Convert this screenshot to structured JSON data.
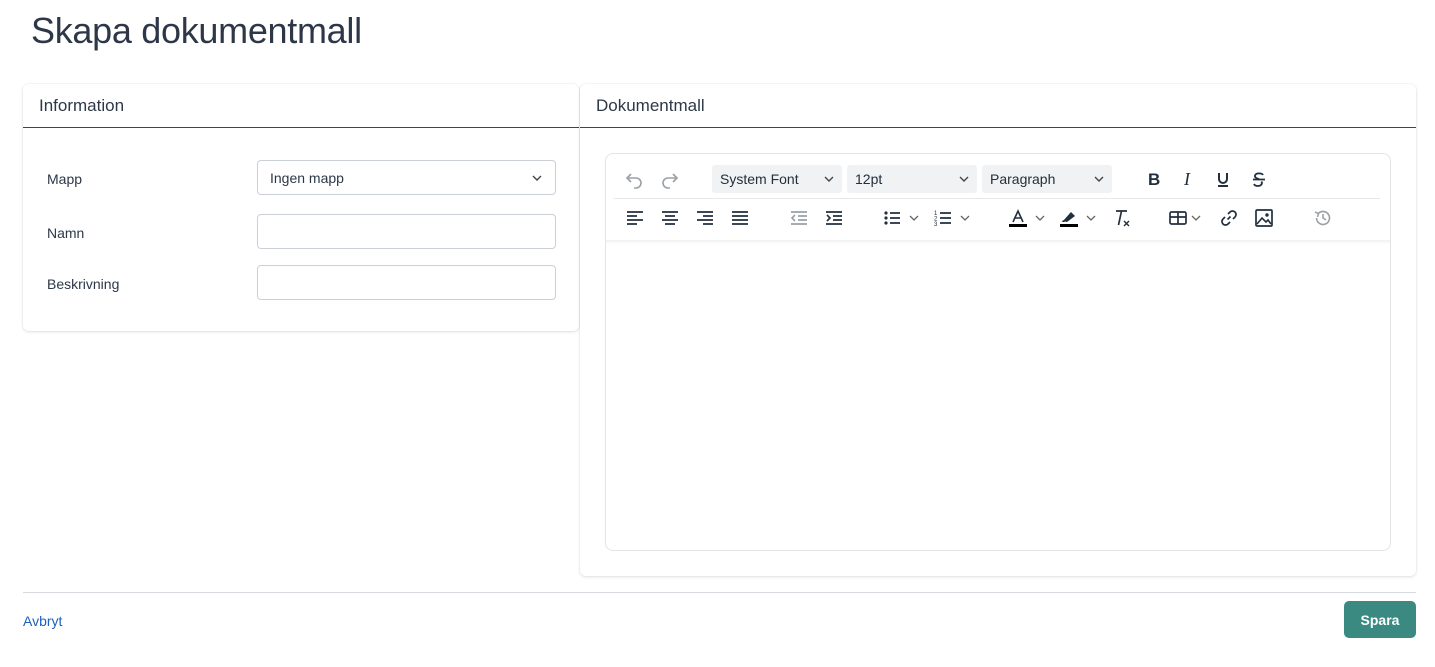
{
  "page": {
    "title": "Skapa dokumentmall"
  },
  "info_card": {
    "header": "Information",
    "fields": {
      "folder": {
        "label": "Mapp",
        "value": "Ingen mapp"
      },
      "name": {
        "label": "Namn",
        "value": "",
        "placeholder": ""
      },
      "description": {
        "label": "Beskrivning",
        "value": "",
        "placeholder": ""
      }
    }
  },
  "doc_card": {
    "header": "Dokumentmall",
    "toolbar": {
      "font_family": "System Font",
      "font_size": "12pt",
      "block_format": "Paragraph",
      "icons": [
        "undo-icon",
        "redo-icon",
        "bold-icon",
        "italic-icon",
        "underline-icon",
        "strikethrough-icon",
        "align-left-icon",
        "align-center-icon",
        "align-right-icon",
        "align-justify-icon",
        "outdent-icon",
        "indent-icon",
        "bullet-list-icon",
        "numbered-list-icon",
        "text-color-icon",
        "highlight-color-icon",
        "clear-formatting-icon",
        "table-icon",
        "link-icon",
        "image-icon",
        "history-icon"
      ]
    }
  },
  "footer": {
    "cancel_label": "Avbryt",
    "save_label": "Spara"
  },
  "colors": {
    "primary": "#3a8a82",
    "link": "#1f5fbf",
    "text": "#2d3748",
    "header_border": "#2d4a55"
  }
}
